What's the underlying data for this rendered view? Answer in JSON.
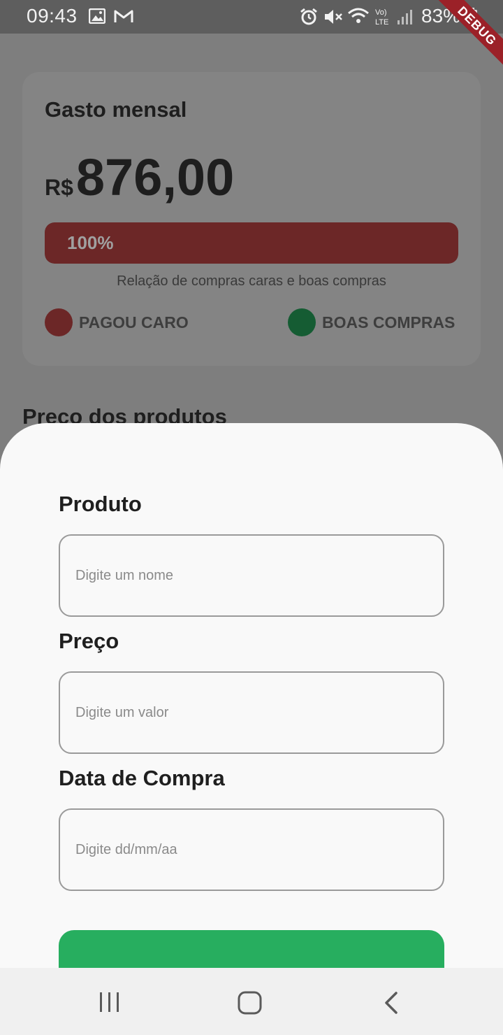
{
  "status_bar": {
    "time": "09:43",
    "battery": "83%",
    "debug_label": "DEBUG",
    "icons": [
      "image-icon",
      "gmail-icon",
      "alarm-icon",
      "mute-icon",
      "wifi-icon",
      "volte-icon",
      "signal-icon",
      "battery-icon"
    ]
  },
  "summary_card": {
    "title": "Gasto mensal",
    "currency": "R$",
    "amount": "876,00",
    "progress_label": "100%",
    "progress_value": 1.0,
    "caption": "Relação de compras caras e boas compras",
    "legend": [
      {
        "label": "PAGOU CARO",
        "color": "#6c2727"
      },
      {
        "label": "BOAS COMPRAS",
        "color": "#155c33"
      }
    ]
  },
  "section_title": "Preco dos produtos",
  "form": {
    "product_label": "Produto",
    "product_placeholder": "Digite um nome",
    "price_label": "Preço",
    "price_placeholder": "Digite um valor",
    "date_label": "Data de Compra",
    "date_placeholder": "Digite dd/mm/aa",
    "submit_color": "#27ae5f"
  },
  "nav": {
    "icons": [
      "recent-apps-icon",
      "home-icon",
      "back-icon"
    ]
  }
}
